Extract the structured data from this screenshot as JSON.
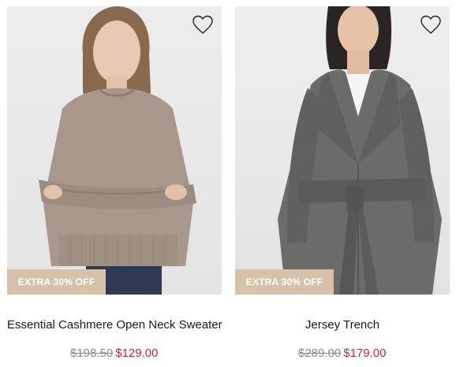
{
  "products": [
    {
      "title": "Essential Cashmere Open Neck Sweater",
      "badge": "EXTRA 30% OFF",
      "original_price": "$198.50",
      "sale_price": "$129.00",
      "wishlist_icon": "heart-outline-icon",
      "image": "woman in beige cashmere sweater"
    },
    {
      "title": "Jersey Trench",
      "badge": "EXTRA 30% OFF",
      "original_price": "$289.00",
      "sale_price": "$179.00",
      "wishlist_icon": "heart-outline-icon",
      "image": "woman in grey belted trench coat"
    }
  ],
  "colors": {
    "badge_bg": "#d8c1aa",
    "sale_price": "#c0273a",
    "original_price": "#8a8a8a"
  }
}
